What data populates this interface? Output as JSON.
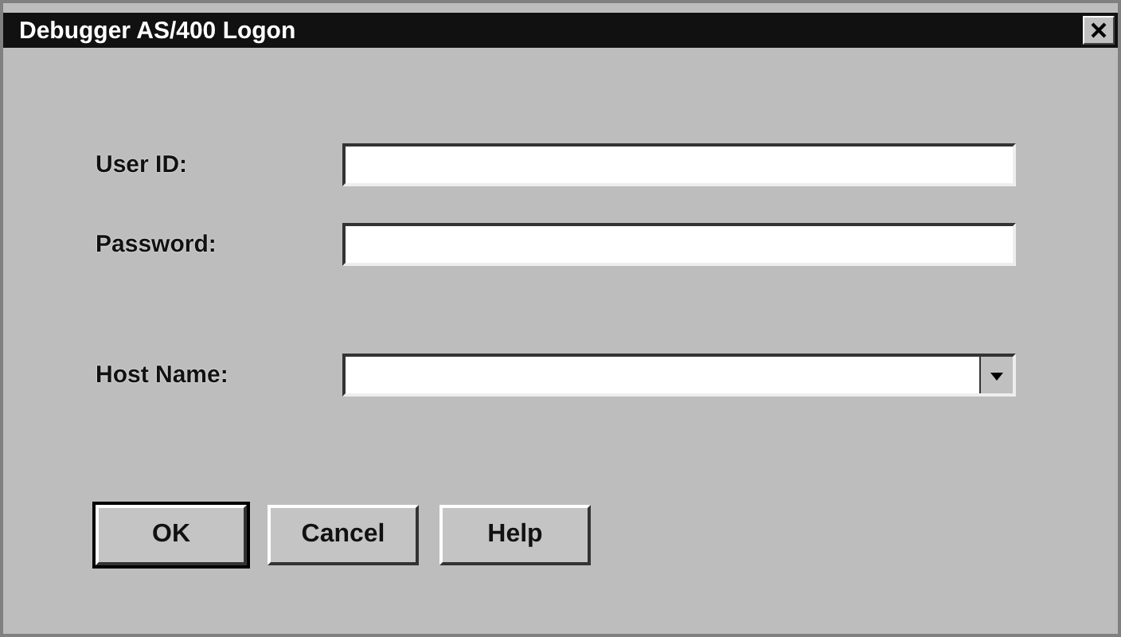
{
  "window": {
    "title": "Debugger AS/400 Logon"
  },
  "fields": [
    {
      "kind": "text",
      "label": "User ID:"
    },
    {
      "kind": "text",
      "label": "Password:"
    },
    {
      "kind": "combo",
      "label": "Host Name:"
    }
  ],
  "buttons": [
    {
      "label": "OK",
      "default": true
    },
    {
      "label": "Cancel",
      "default": false
    },
    {
      "label": "Help",
      "default": false
    }
  ]
}
